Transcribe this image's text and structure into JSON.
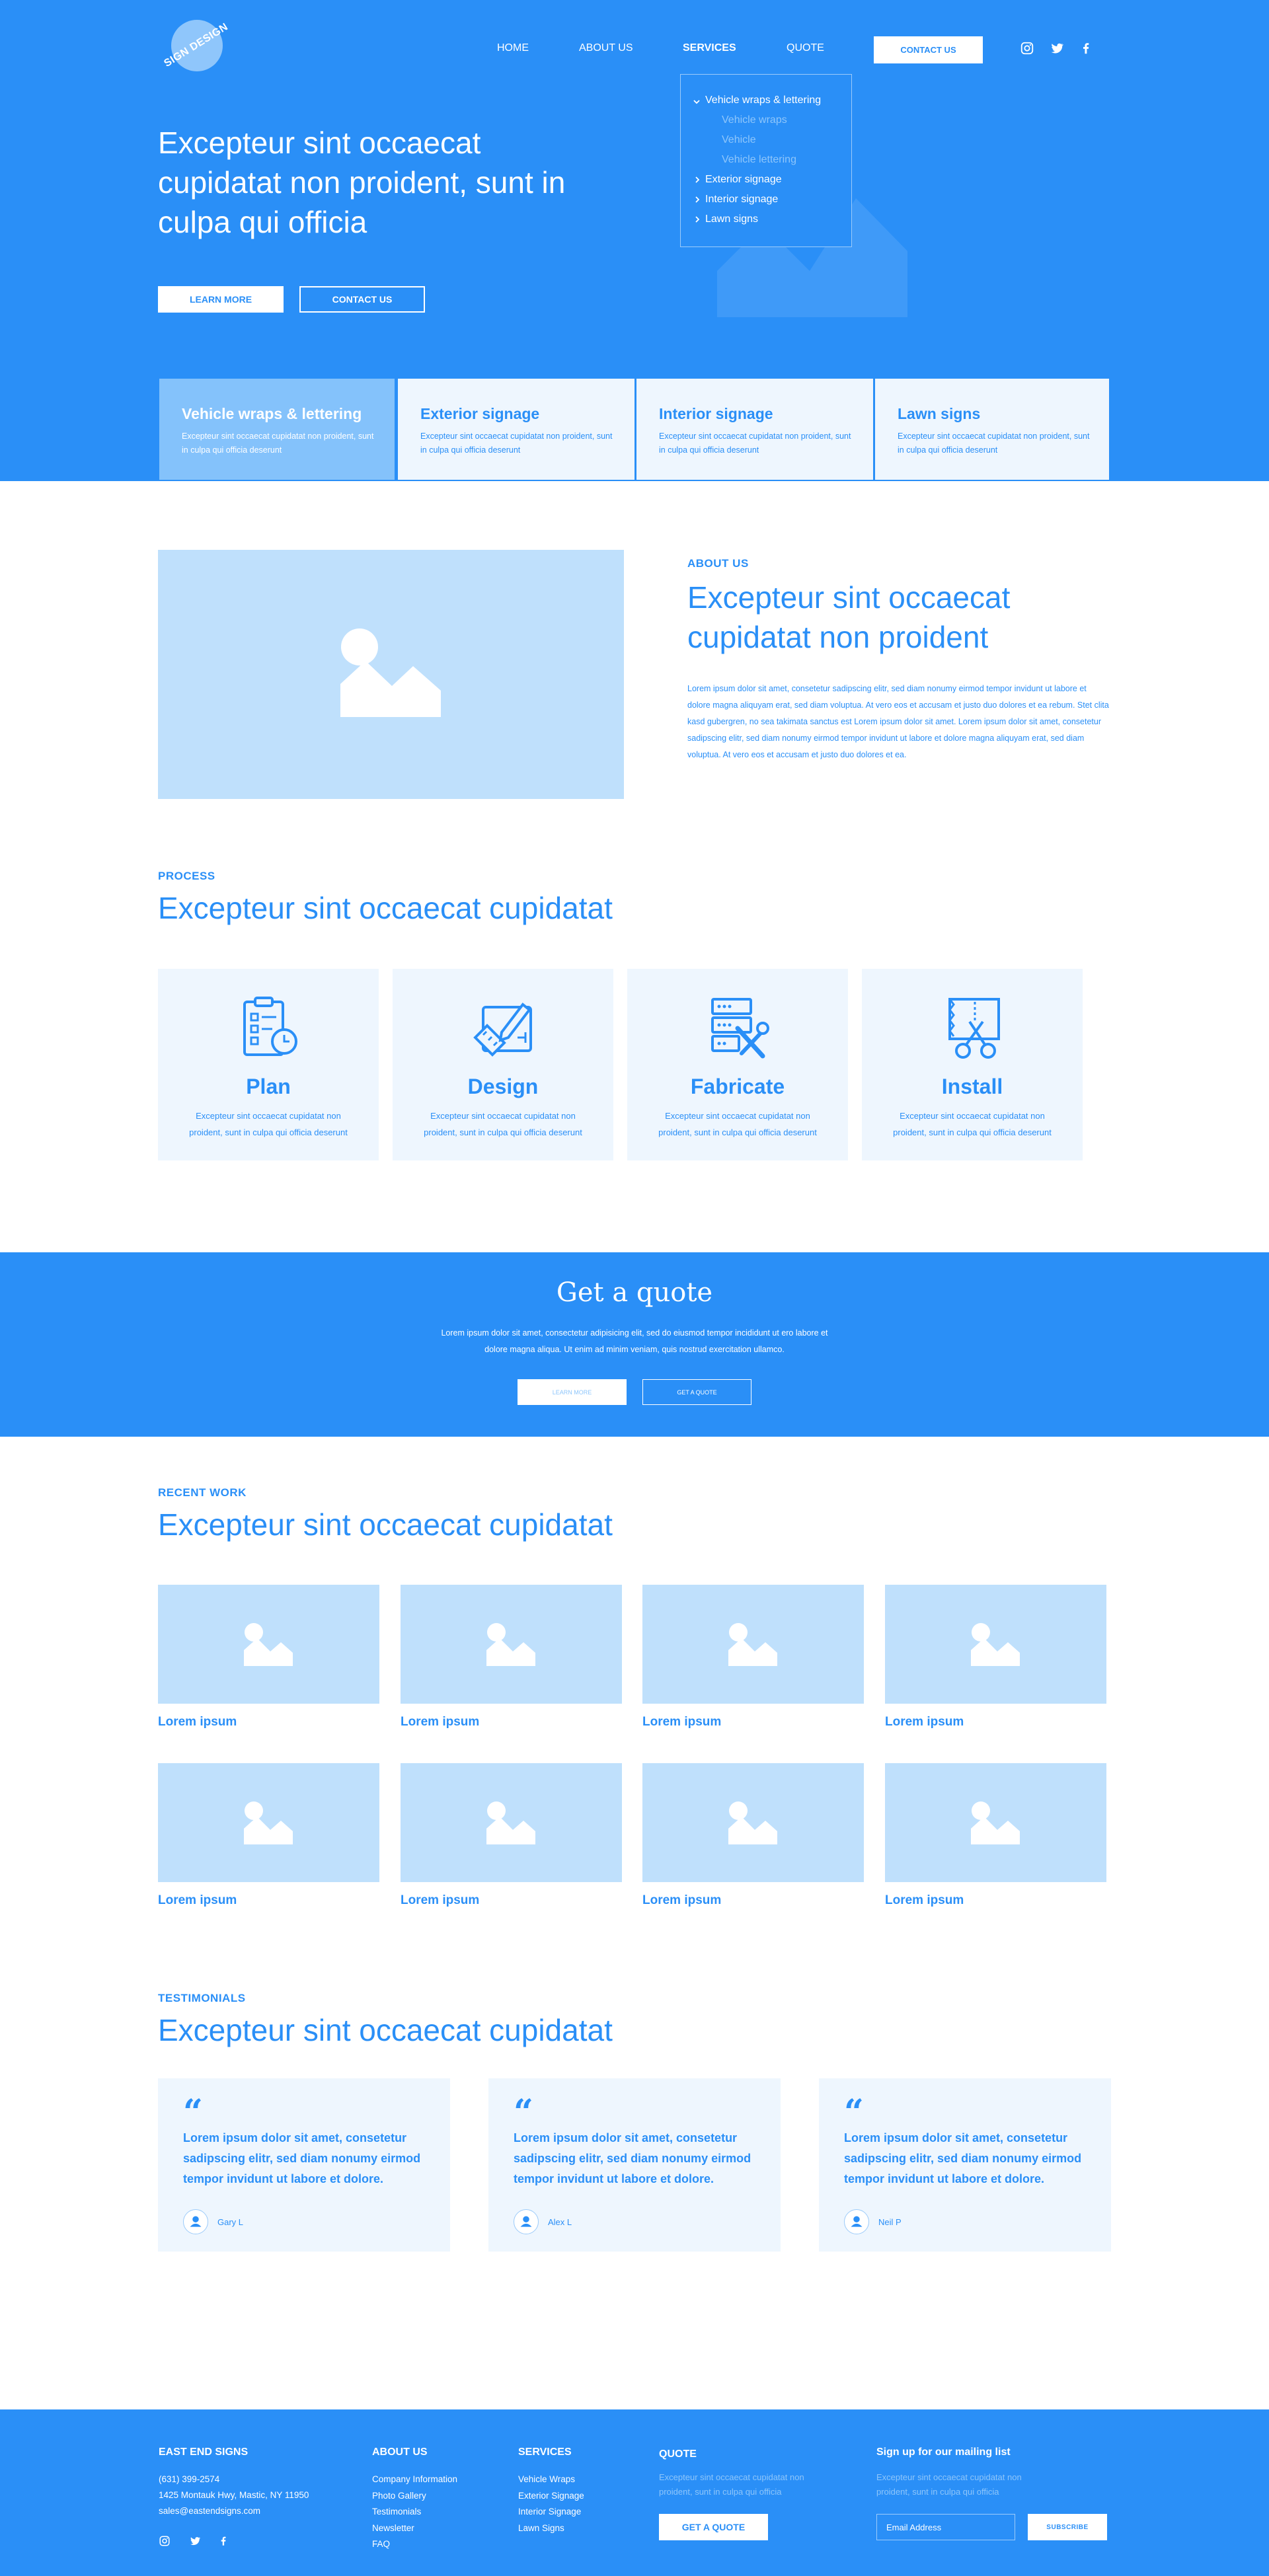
{
  "brand": {
    "logo_text": "SIGN DESIGN"
  },
  "nav": {
    "items": [
      "HOME",
      "ABOUT US",
      "SERVICES",
      "QUOTE"
    ],
    "contact": "CONTACT US",
    "social_icons": [
      "instagram-icon",
      "twitter-icon",
      "facebook-icon"
    ]
  },
  "services_menu": {
    "open_item": "Vehicle wraps & lettering",
    "sub_items": [
      "Vehicle wraps",
      "Vehicle",
      "Vehicle lettering"
    ],
    "other_items": [
      "Exterior signage",
      "Interior signage",
      "Lawn signs"
    ]
  },
  "hero": {
    "title": "Excepteur sint occaecat cupidatat non proident, sunt in culpa qui officia",
    "learn_more": "LEARN MORE",
    "contact_us": "CONTACT US"
  },
  "service_cards": [
    {
      "title": "Vehicle wraps & lettering",
      "desc": "Excepteur sint occaecat cupidatat non proident, sunt in culpa qui officia deserunt"
    },
    {
      "title": "Exterior signage",
      "desc": "Excepteur sint occaecat cupidatat non proident, sunt in culpa qui officia deserunt"
    },
    {
      "title": "Interior signage",
      "desc": "Excepteur sint occaecat cupidatat non proident, sunt in culpa qui officia deserunt"
    },
    {
      "title": "Lawn signs",
      "desc": "Excepteur sint occaecat cupidatat non proident, sunt in culpa qui officia deserunt"
    }
  ],
  "about": {
    "eyebrow": "ABOUT US",
    "title": "Excepteur sint occaecat cupidatat non proident",
    "body": "Lorem ipsum dolor sit amet, consetetur sadipscing elitr, sed diam nonumy eirmod tempor invidunt ut labore et dolore magna aliquyam erat, sed diam voluptua. At vero eos et accusam et justo duo dolores et ea rebum. Stet clita kasd gubergren, no sea takimata sanctus est Lorem ipsum dolor sit amet. Lorem ipsum dolor sit amet, consetetur sadipscing elitr, sed diam nonumy eirmod tempor invidunt ut labore et dolore magna aliquyam erat, sed diam voluptua. At vero eos et accusam et justo duo dolores et ea."
  },
  "process": {
    "eyebrow": "PROCESS",
    "title": "Excepteur sint occaecat cupidatat",
    "steps": [
      {
        "title": "Plan",
        "icon": "clipboard-clock-icon",
        "desc": "Excepteur sint occaecat cupidatat non proident, sunt in culpa qui officia deserunt"
      },
      {
        "title": "Design",
        "icon": "design-tools-icon",
        "desc": "Excepteur sint occaecat cupidatat non proident, sunt in culpa qui officia deserunt"
      },
      {
        "title": "Fabricate",
        "icon": "server-tools-icon",
        "desc": "Excepteur sint occaecat cupidatat non proident, sunt in culpa qui officia deserunt"
      },
      {
        "title": "Install",
        "icon": "scissors-banner-icon",
        "desc": "Excepteur sint occaecat cupidatat non proident, sunt in culpa qui officia deserunt"
      }
    ]
  },
  "quote_banner": {
    "title": "Get a quote",
    "body": "Lorem ipsum dolor sit amet, consectetur adipisicing elit, sed do eiusmod tempor incididunt ut ero labore et dolore magna aliqua. Ut enim ad minim veniam, quis nostrud exercitation ullamco.",
    "learn_more": "LEARN MORE",
    "get_quote": "GET A QUOTE"
  },
  "recent_work": {
    "eyebrow": "RECENT WORK",
    "title": "Excepteur sint occaecat cupidatat",
    "items": [
      "Lorem ipsum",
      "Lorem ipsum",
      "Lorem ipsum",
      "Lorem ipsum",
      "Lorem ipsum",
      "Lorem ipsum",
      "Lorem ipsum",
      "Lorem ipsum"
    ]
  },
  "testimonials": {
    "eyebrow": "TESTIMONIALS",
    "title": "Excepteur sint occaecat cupidatat",
    "quote_mark": "“",
    "items": [
      {
        "text": "Lorem ipsum dolor sit amet, consetetur sadipscing elitr, sed diam nonumy eirmod tempor invidunt ut labore et dolore.",
        "name": "Gary L"
      },
      {
        "text": "Lorem ipsum dolor sit amet, consetetur sadipscing elitr, sed diam nonumy eirmod tempor invidunt ut labore et dolore.",
        "name": "Alex L"
      },
      {
        "text": "Lorem ipsum dolor sit amet, consetetur sadipscing elitr, sed diam nonumy eirmod tempor invidunt ut labore et dolore.",
        "name": "Neil P"
      }
    ]
  },
  "footer": {
    "company": {
      "heading": "EAST END SIGNS",
      "phone": "(631) 399-2574",
      "address": "1425 Montauk Hwy, Mastic, NY 11950",
      "email": "sales@eastendsigns.com"
    },
    "about": {
      "heading": "ABOUT US",
      "links": [
        "Company Information",
        "Photo Gallery",
        "Testimonials",
        "Newsletter",
        "FAQ"
      ]
    },
    "services": {
      "heading": "SERVICES",
      "links": [
        "Vehicle Wraps",
        "Exterior Signage",
        "Interior Signage",
        "Lawn Signs"
      ]
    },
    "quote": {
      "heading": "QUOTE",
      "desc": "Excepteur sint occaecat cupidatat non proident, sunt in culpa qui officia",
      "button": "GET A QUOTE"
    },
    "mailing": {
      "heading": "Sign up for our mailing list",
      "desc": "Excepteur sint occaecat cupidatat non proident, sunt in culpa qui officia",
      "placeholder": "Email Address",
      "button": "SUBSCRIBE"
    }
  },
  "colors": {
    "primary": "#2a8ff7",
    "light": "#bfe0fc",
    "pale": "#eef6fe",
    "active_card": "#84c2fb"
  }
}
